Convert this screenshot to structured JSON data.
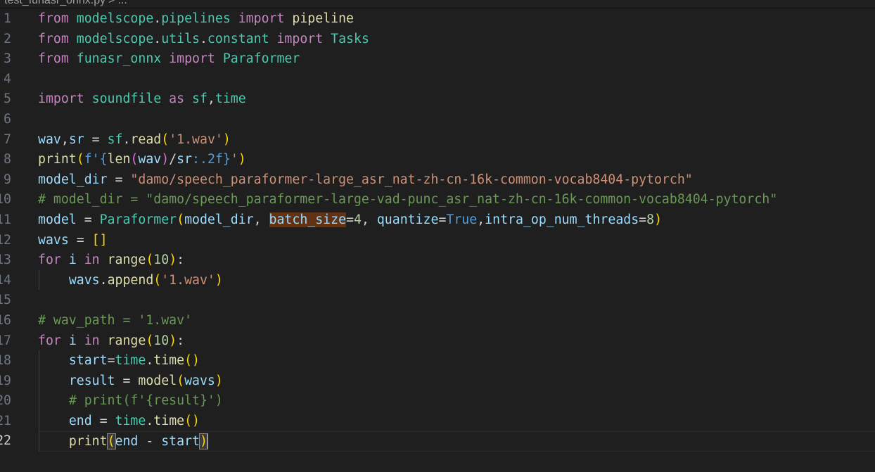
{
  "breadcrumb": {
    "file": "test_funasr_onnx.py",
    "sep": ">",
    "rest": "..."
  },
  "colors": {
    "background": "#1f1f1f",
    "keyword": "#c586c0",
    "class": "#4ec9b0",
    "function": "#dcdcaa",
    "variable": "#9cdcfe",
    "string": "#ce9178",
    "number": "#b5cea8",
    "comment": "#6a9955",
    "constant": "#569cd6",
    "highlight": "#613214"
  },
  "editor": {
    "current_line": "22",
    "lines": [
      {
        "n": "1",
        "tokens": [
          [
            "from",
            "kw"
          ],
          [
            " ",
            ""
          ],
          [
            "modelscope",
            "mod"
          ],
          [
            ".",
            "op"
          ],
          [
            "pipelines",
            "mod"
          ],
          [
            " ",
            ""
          ],
          [
            "import",
            "kw"
          ],
          [
            " ",
            ""
          ],
          [
            "pipeline",
            "fn"
          ]
        ]
      },
      {
        "n": "2",
        "tokens": [
          [
            "from",
            "kw"
          ],
          [
            " ",
            ""
          ],
          [
            "modelscope",
            "mod"
          ],
          [
            ".",
            "op"
          ],
          [
            "utils",
            "mod"
          ],
          [
            ".",
            "op"
          ],
          [
            "constant",
            "mod"
          ],
          [
            " ",
            ""
          ],
          [
            "import",
            "kw"
          ],
          [
            " ",
            ""
          ],
          [
            "Tasks",
            "mod"
          ]
        ]
      },
      {
        "n": "3",
        "tokens": [
          [
            "from",
            "kw"
          ],
          [
            " ",
            ""
          ],
          [
            "funasr_onnx",
            "mod"
          ],
          [
            " ",
            ""
          ],
          [
            "import",
            "kw"
          ],
          [
            " ",
            ""
          ],
          [
            "Paraformer",
            "mod"
          ]
        ]
      },
      {
        "n": "4",
        "tokens": []
      },
      {
        "n": "5",
        "tokens": [
          [
            "import",
            "kw"
          ],
          [
            " ",
            ""
          ],
          [
            "soundfile",
            "mod"
          ],
          [
            " ",
            ""
          ],
          [
            "as",
            "kw"
          ],
          [
            " ",
            ""
          ],
          [
            "sf",
            "mod"
          ],
          [
            ",",
            "op"
          ],
          [
            "time",
            "mod"
          ]
        ]
      },
      {
        "n": "6",
        "tokens": []
      },
      {
        "n": "7",
        "tokens": [
          [
            "wav",
            "var"
          ],
          [
            ",",
            "op"
          ],
          [
            "sr",
            "var"
          ],
          [
            " = ",
            "op"
          ],
          [
            "sf",
            "mod"
          ],
          [
            ".",
            "op"
          ],
          [
            "read",
            "fn"
          ],
          [
            "(",
            "br1"
          ],
          [
            "'1.wav'",
            "str"
          ],
          [
            ")",
            "br1"
          ]
        ]
      },
      {
        "n": "8",
        "tokens": [
          [
            "print",
            "fn"
          ],
          [
            "(",
            "br1"
          ],
          [
            "f'",
            "kw2"
          ],
          [
            "{",
            "kw2"
          ],
          [
            "len",
            "fn"
          ],
          [
            "(",
            "br2"
          ],
          [
            "wav",
            "var"
          ],
          [
            ")",
            "br2"
          ],
          [
            "/",
            "op"
          ],
          [
            "sr",
            "var"
          ],
          [
            ":.2f",
            "kw2"
          ],
          [
            "}",
            "kw2"
          ],
          [
            "'",
            "str"
          ],
          [
            ")",
            "br1"
          ]
        ]
      },
      {
        "n": "9",
        "tokens": [
          [
            "model_dir",
            "var"
          ],
          [
            " = ",
            "op"
          ],
          [
            "\"damo/speech_paraformer-large_asr_nat-zh-cn-16k-common-vocab8404-pytorch\"",
            "str"
          ]
        ]
      },
      {
        "n": "10",
        "tokens": [
          [
            "# model_dir = \"damo/speech_paraformer-large-vad-punc_asr_nat-zh-cn-16k-common-vocab8404-pytorch\"",
            "cmt"
          ]
        ]
      },
      {
        "n": "11",
        "tokens": [
          [
            "model",
            "var"
          ],
          [
            " = ",
            "op"
          ],
          [
            "Paraformer",
            "mod"
          ],
          [
            "(",
            "br1"
          ],
          [
            "model_dir",
            "var"
          ],
          [
            ", ",
            "op"
          ],
          [
            "batch_size",
            "var hl"
          ],
          [
            "=",
            "op"
          ],
          [
            "4",
            "num"
          ],
          [
            ", ",
            "op"
          ],
          [
            "quantize",
            "var"
          ],
          [
            "=",
            "op"
          ],
          [
            "True",
            "kw2"
          ],
          [
            ",",
            "op"
          ],
          [
            "intra_op_num_threads",
            "var"
          ],
          [
            "=",
            "op"
          ],
          [
            "8",
            "num"
          ],
          [
            ")",
            "br1"
          ]
        ]
      },
      {
        "n": "12",
        "tokens": [
          [
            "wavs",
            "var"
          ],
          [
            " = ",
            "op"
          ],
          [
            "[]",
            "br1"
          ]
        ]
      },
      {
        "n": "13",
        "tokens": [
          [
            "for",
            "kw"
          ],
          [
            " ",
            ""
          ],
          [
            "i",
            "var"
          ],
          [
            " ",
            ""
          ],
          [
            "in",
            "kw"
          ],
          [
            " ",
            ""
          ],
          [
            "range",
            "fn"
          ],
          [
            "(",
            "br1"
          ],
          [
            "10",
            "num"
          ],
          [
            ")",
            "br1"
          ],
          [
            ":",
            "op"
          ]
        ]
      },
      {
        "n": "14",
        "tokens": [
          [
            "    ",
            ""
          ],
          [
            "wavs",
            "var"
          ],
          [
            ".",
            "op"
          ],
          [
            "append",
            "fn"
          ],
          [
            "(",
            "br1"
          ],
          [
            "'1.wav'",
            "str"
          ],
          [
            ")",
            "br1"
          ]
        ]
      },
      {
        "n": "15",
        "tokens": []
      },
      {
        "n": "16",
        "tokens": [
          [
            "# wav_path = '1.wav'",
            "cmt"
          ]
        ]
      },
      {
        "n": "17",
        "tokens": [
          [
            "for",
            "kw"
          ],
          [
            " ",
            ""
          ],
          [
            "i",
            "var"
          ],
          [
            " ",
            ""
          ],
          [
            "in",
            "kw"
          ],
          [
            " ",
            ""
          ],
          [
            "range",
            "fn"
          ],
          [
            "(",
            "br1"
          ],
          [
            "10",
            "num"
          ],
          [
            ")",
            "br1"
          ],
          [
            ":",
            "op"
          ]
        ]
      },
      {
        "n": "18",
        "tokens": [
          [
            "    ",
            ""
          ],
          [
            "start",
            "var"
          ],
          [
            "=",
            "op"
          ],
          [
            "time",
            "mod"
          ],
          [
            ".",
            "op"
          ],
          [
            "time",
            "fn"
          ],
          [
            "()",
            "br1"
          ]
        ]
      },
      {
        "n": "19",
        "tokens": [
          [
            "    ",
            ""
          ],
          [
            "result",
            "var"
          ],
          [
            " = ",
            "op"
          ],
          [
            "model",
            "fn"
          ],
          [
            "(",
            "br1"
          ],
          [
            "wavs",
            "var"
          ],
          [
            ")",
            "br1"
          ]
        ]
      },
      {
        "n": "20",
        "tokens": [
          [
            "    ",
            ""
          ],
          [
            "# print(f'{result}')",
            "cmt"
          ]
        ]
      },
      {
        "n": "21",
        "tokens": [
          [
            "    ",
            ""
          ],
          [
            "end",
            "var"
          ],
          [
            " = ",
            "op"
          ],
          [
            "time",
            "mod"
          ],
          [
            ".",
            "op"
          ],
          [
            "time",
            "fn"
          ],
          [
            "()",
            "br1"
          ]
        ]
      },
      {
        "n": "22",
        "tokens": [
          [
            "    ",
            ""
          ],
          [
            "print",
            "fn"
          ],
          [
            "(",
            "br1 bm"
          ],
          [
            "end",
            "var"
          ],
          [
            " - ",
            "op"
          ],
          [
            "start",
            "var"
          ],
          [
            ")",
            "br1 bm"
          ],
          [
            "|",
            "cursor"
          ]
        ]
      }
    ]
  }
}
